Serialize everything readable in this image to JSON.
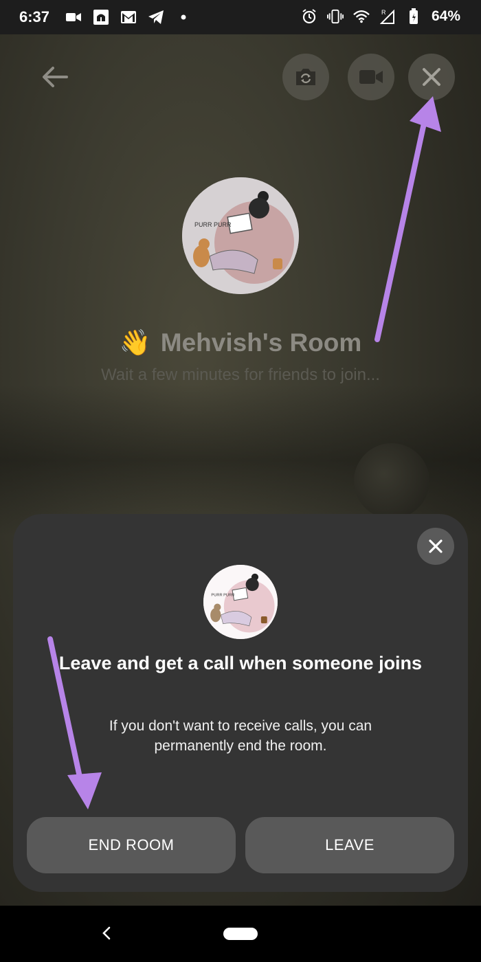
{
  "status_bar": {
    "time": "6:37",
    "battery": "64%",
    "icons_left": [
      "video-camera-icon",
      "mosque-icon",
      "gmail-icon",
      "telegram-icon",
      "dot-icon"
    ],
    "icons_right": [
      "alarm-icon",
      "vibrate-icon",
      "wifi-icon",
      "signal-icon",
      "battery-icon"
    ]
  },
  "top_controls": {
    "back_icon": "arrow-left-icon",
    "buttons": [
      "switch-camera-icon",
      "video-camera-icon",
      "close-icon"
    ]
  },
  "room": {
    "emoji": "👋",
    "title": "Mehvish's Room",
    "subtitle": "Wait a few minutes for friends to join..."
  },
  "sheet": {
    "title": "Leave and get a call when someone joins",
    "body": "If you don't want to receive calls, you can permanently end the room.",
    "end_room_label": "END ROOM",
    "leave_label": "LEAVE",
    "close_icon": "close-icon"
  },
  "colors": {
    "sheet_bg": "#343434",
    "button_bg": "#595959",
    "annotation_arrow": "#b784e8"
  },
  "avatar_text": "PURR PURR"
}
